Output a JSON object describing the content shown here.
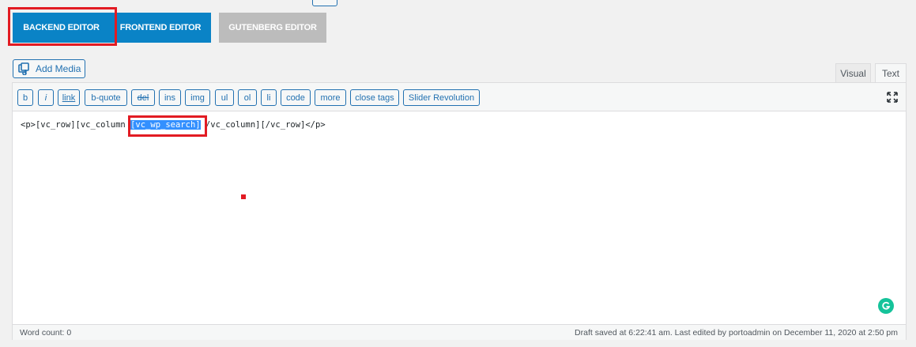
{
  "editor_modes": {
    "backend": "BACKEND EDITOR",
    "frontend": "FRONTEND EDITOR",
    "gutenberg": "GUTENBERG EDITOR"
  },
  "media": {
    "add_media_label": "Add Media"
  },
  "tabs": {
    "visual": "Visual",
    "text": "Text"
  },
  "quicktags": {
    "b": "b",
    "i": "i",
    "link": "link",
    "bquote": "b-quote",
    "del": "del",
    "ins": "ins",
    "img": "img",
    "ul": "ul",
    "ol": "ol",
    "li": "li",
    "code": "code",
    "more": "more",
    "close_tags": "close tags",
    "slider_revolution": "Slider Revolution"
  },
  "content": {
    "before": "<p>[vc_row][vc_column",
    "selected": "[vc_wp_search]",
    "after": " /vc_column][/vc_row]</p>"
  },
  "status": {
    "word_count": "Word count: 0",
    "draft_info": "Draft saved at 6:22:41 am. Last edited by portoadmin on December 11, 2020 at 2:50 pm"
  },
  "colors": {
    "primary_blue": "#0a83c6",
    "disabled_gray": "#bcbcbc",
    "highlight_red": "#e21b23",
    "selection_blue": "#3390ff",
    "grammarly_green": "#15c39a"
  }
}
